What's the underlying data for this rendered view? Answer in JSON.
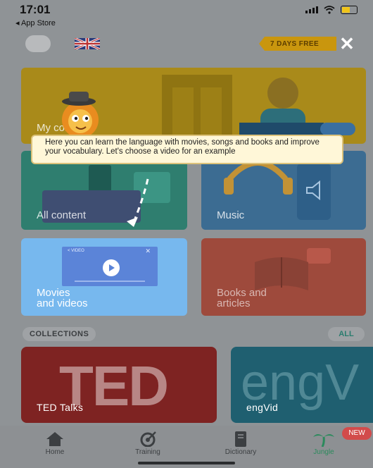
{
  "status_bar": {
    "time": "17:01",
    "back_label": "◂ App Store"
  },
  "header": {
    "trial_badge": "7 DAYS FREE",
    "close_icon": "close-icon",
    "flag_icon": "uk-flag-icon"
  },
  "tiles": {
    "my_content": "My content",
    "all_content": "All content",
    "music": "Music",
    "movies": "Movies\nand videos",
    "books": "Books and\narticles"
  },
  "tooltip": {
    "text": "Here you can learn the language with movies, songs and books and improve your vocabulary. Let's choose a video for an example"
  },
  "video_preview": {
    "label": "< VIDEO"
  },
  "collections": {
    "label": "COLLECTIONS",
    "all_label": "ALL",
    "items": [
      {
        "big": "TED",
        "name": "TED Talks"
      },
      {
        "big": "engV",
        "name": "engVid"
      }
    ]
  },
  "tabbar": {
    "items": [
      {
        "label": "Home",
        "icon": "home-icon"
      },
      {
        "label": "Training",
        "icon": "training-icon"
      },
      {
        "label": "Dictionary",
        "icon": "dictionary-icon"
      },
      {
        "label": "Jungle",
        "icon": "palm-tree-icon"
      }
    ],
    "new_badge": "NEW"
  },
  "colors": {
    "accent": "#2b8a5c",
    "movies_tile": "#77b8ee",
    "trial_badge": "#c9960e"
  }
}
